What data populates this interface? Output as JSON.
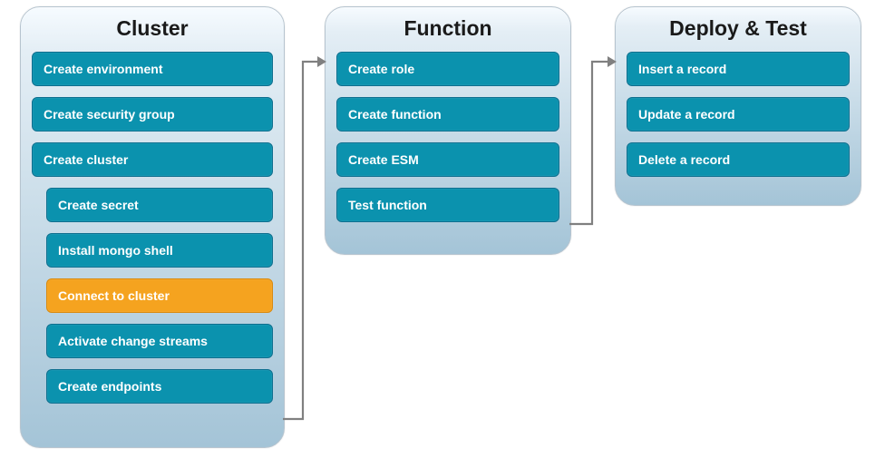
{
  "groups": {
    "cluster": {
      "title": "Cluster",
      "items": [
        "Create environment",
        "Create security group",
        "Create cluster",
        "Create secret",
        "Install mongo shell",
        "Connect to cluster",
        "Activate change streams",
        "Create endpoints"
      ],
      "active_index": 5
    },
    "function": {
      "title": "Function",
      "items": [
        "Create role",
        "Create function",
        "Create ESM",
        "Test function"
      ]
    },
    "deploy": {
      "title": "Deploy & Test",
      "items": [
        "Insert a record",
        "Update a record",
        "Delete a record"
      ]
    }
  },
  "colors": {
    "step_bg": "#0b92ae",
    "step_active_bg": "#f5a31f",
    "step_text": "#ffffff",
    "group_border": "#b6c4cf",
    "arrow": "#808080"
  },
  "chart_data": {
    "type": "table",
    "title": "Workflow steps diagram",
    "flow": [
      "Cluster",
      "Function",
      "Deploy & Test"
    ],
    "highlighted_step": "Connect to cluster",
    "groups": [
      {
        "name": "Cluster",
        "steps": [
          "Create environment",
          "Create security group",
          "Create cluster",
          "Create secret",
          "Install mongo shell",
          "Connect to cluster",
          "Activate change streams",
          "Create endpoints"
        ]
      },
      {
        "name": "Function",
        "steps": [
          "Create role",
          "Create function",
          "Create ESM",
          "Test function"
        ]
      },
      {
        "name": "Deploy & Test",
        "steps": [
          "Insert a record",
          "Update a record",
          "Delete a record"
        ]
      }
    ]
  }
}
